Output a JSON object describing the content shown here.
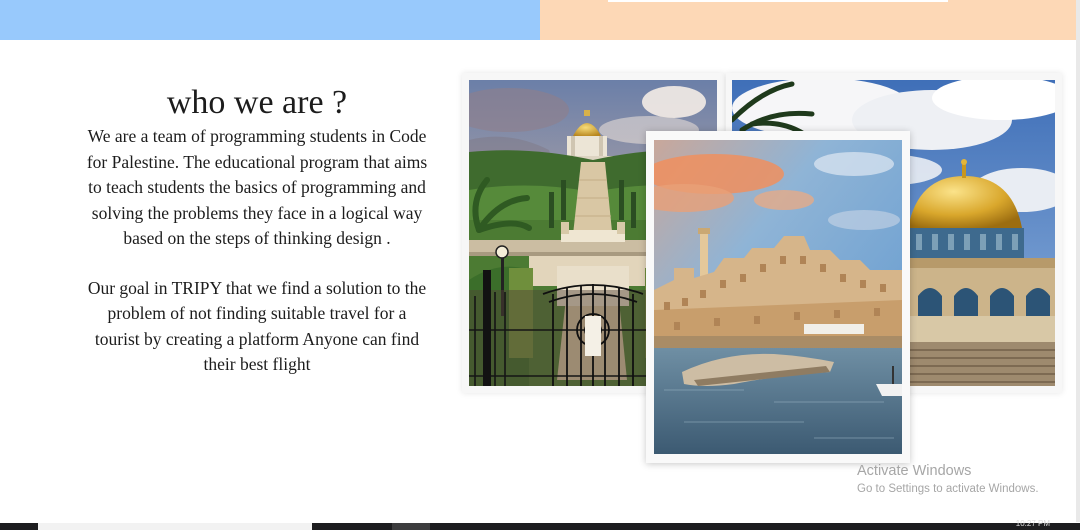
{
  "header": {
    "left_color": "#98c9fc",
    "right_color": "#fdd8b6"
  },
  "about": {
    "title": "who we are ?",
    "intro": "We are a team of programming students in Code for Palestine. The educational program that aims to teach students the basics of programming and solving the problems they face in a logical way based on the steps of thinking design .",
    "goal": "Our goal in TRIPY that we find a solution to the problem of not finding suitable travel for a tourist by creating a platform Anyone can find their best flight"
  },
  "gallery": {
    "photos": [
      {
        "name": "haifa-gardens-photo"
      },
      {
        "name": "jaffa-port-photo"
      },
      {
        "name": "dome-of-the-rock-photo"
      }
    ]
  },
  "watermark": {
    "title": "Activate Windows",
    "subtitle": "Go to Settings to activate Windows."
  },
  "taskbar": {
    "clock": "10:27 PM"
  }
}
